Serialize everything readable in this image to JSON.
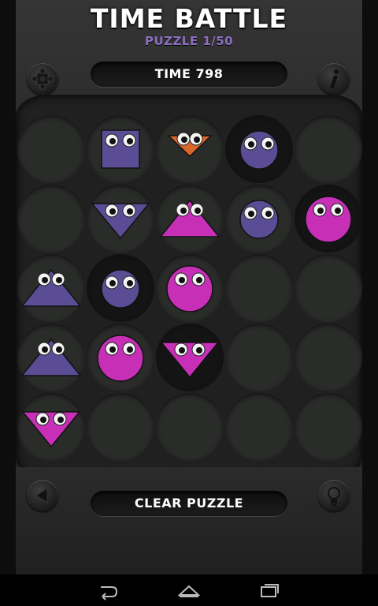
{
  "game": {
    "title": "TIME BATTLE",
    "subtitle": "PUZZLE 1/50",
    "timer": "TIME 798",
    "clear_button": "CLEAR PUZZLE"
  },
  "buttons": {
    "settings": "gear-icon",
    "info": "info-icon",
    "back": "back-arrow-icon",
    "hint": "lightbulb-icon"
  },
  "board": {
    "rows": 5,
    "cols": 5,
    "cells": [
      {
        "shape": null,
        "color": null
      },
      {
        "shape": "square",
        "color": "purple"
      },
      {
        "shape": "triangle-down",
        "color": "orange"
      },
      {
        "shape": "circle",
        "color": "purple"
      },
      {
        "shape": null,
        "color": null
      },
      {
        "shape": null,
        "color": null
      },
      {
        "shape": "triangle-down",
        "color": "purple"
      },
      {
        "shape": "triangle-up",
        "color": "pink"
      },
      {
        "shape": "circle",
        "color": "purple"
      },
      {
        "shape": "circle",
        "color": "pink"
      },
      {
        "shape": "triangle-up",
        "color": "purple"
      },
      {
        "shape": "circle",
        "color": "purple"
      },
      {
        "shape": "circle",
        "color": "pink"
      },
      {
        "shape": null,
        "color": null
      },
      {
        "shape": null,
        "color": null
      },
      {
        "shape": "triangle-up",
        "color": "purple"
      },
      {
        "shape": "circle",
        "color": "pink"
      },
      {
        "shape": "triangle-down",
        "color": "pink"
      },
      {
        "shape": null,
        "color": null
      },
      {
        "shape": null,
        "color": null
      },
      {
        "shape": "triangle-down",
        "color": "pink"
      },
      {
        "shape": null,
        "color": null
      },
      {
        "shape": null,
        "color": null
      },
      {
        "shape": null,
        "color": null
      },
      {
        "shape": null,
        "color": null
      }
    ]
  },
  "colors": {
    "purple": "#5b4d95",
    "pink": "#c72fb6",
    "orange": "#d9662a",
    "subtitle": "#8a6fbf"
  },
  "navbar": {
    "back": "nav-back-icon",
    "home": "nav-home-icon",
    "recents": "nav-recents-icon"
  }
}
